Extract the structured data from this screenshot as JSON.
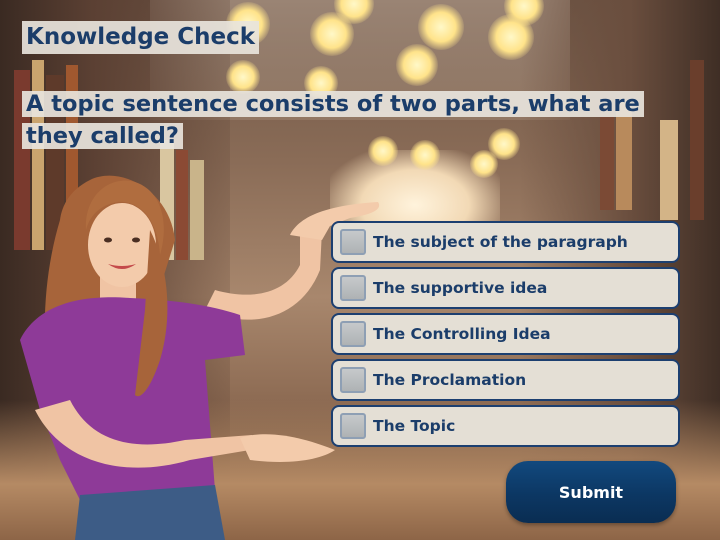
{
  "quiz": {
    "title": "Knowledge Check",
    "question": "A topic sentence consists of two parts, what are they called?",
    "options": [
      {
        "label": "The subject of the paragraph",
        "checked": false
      },
      {
        "label": "The supportive idea",
        "checked": false
      },
      {
        "label": "The Controlling Idea",
        "checked": false
      },
      {
        "label": "The Proclamation",
        "checked": false
      },
      {
        "label": "The Topic",
        "checked": false
      }
    ],
    "submit_label": "Submit"
  },
  "colors": {
    "title_text": "#1b3d6a",
    "option_border": "#1c3f70",
    "option_fill": "#e4dfd5",
    "submit_fill": "#0c3763"
  }
}
